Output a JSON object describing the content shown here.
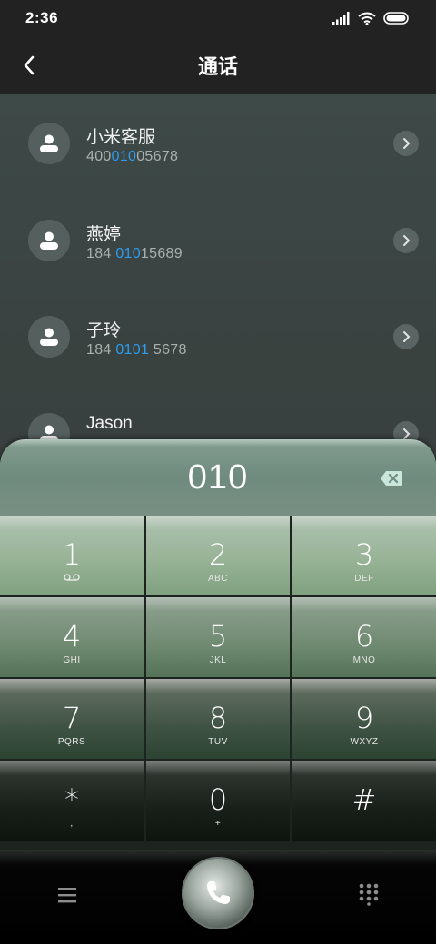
{
  "status_bar": {
    "time": "2:36"
  },
  "header": {
    "title": "通话"
  },
  "contacts": [
    {
      "name": "小米客服",
      "number_pre": "400",
      "number_match": "010",
      "number_post": "05678"
    },
    {
      "name": "燕婷",
      "number_pre": "184 ",
      "number_match": "010",
      "number_post": "15689"
    },
    {
      "name": "子玲",
      "number_pre": "184 ",
      "number_match": "0101",
      "number_post": " 5678"
    },
    {
      "name": "Jason",
      "number_pre": "",
      "number_match": "",
      "number_post": ""
    }
  ],
  "dialer": {
    "input": "010",
    "keys": [
      {
        "num": "1",
        "sub": ""
      },
      {
        "num": "2",
        "sub": "ABC"
      },
      {
        "num": "3",
        "sub": "DEF"
      },
      {
        "num": "4",
        "sub": "GHI"
      },
      {
        "num": "5",
        "sub": "JKL"
      },
      {
        "num": "6",
        "sub": "MNO"
      },
      {
        "num": "7",
        "sub": "PQRS"
      },
      {
        "num": "8",
        "sub": "TUV"
      },
      {
        "num": "9",
        "sub": "WXYZ"
      },
      {
        "num": "*",
        "sub": ","
      },
      {
        "num": "0",
        "sub": "+"
      },
      {
        "num": "#",
        "sub": ""
      }
    ]
  },
  "colors": {
    "match_highlight": "#2d9cf0",
    "header_bg": "#222222",
    "list_bg": "#3e4a48"
  },
  "icons": {
    "back": "chevron-left-icon",
    "avatar": "person-icon",
    "row_action": "chevron-right-icon",
    "delete": "backspace-icon",
    "voicemail": "voicemail-icon",
    "menu": "menu-icon",
    "call": "phone-icon",
    "dialpad": "dialpad-icon"
  }
}
